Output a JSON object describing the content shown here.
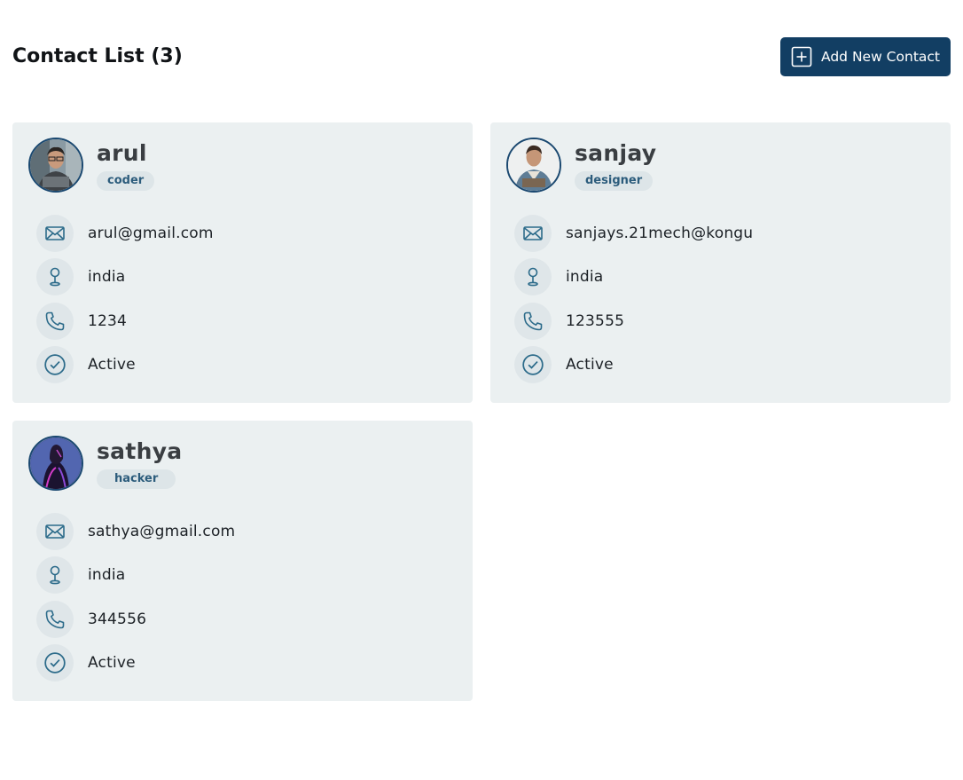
{
  "header": {
    "title": "Contact List (3)",
    "add_button_label": "Add New Contact"
  },
  "colors": {
    "accent": "#123e63",
    "card_bg": "#ebf0f1",
    "icon": "#2c6b8a"
  },
  "contacts": [
    {
      "name": "arul",
      "role": "coder",
      "email": "arul@gmail.com",
      "location": "india",
      "phone": "1234",
      "status": "Active"
    },
    {
      "name": "sanjay",
      "role": "designer",
      "email": "sanjays.21mech@kongu",
      "location": "india",
      "phone": "123555",
      "status": "Active"
    },
    {
      "name": "sathya",
      "role": "hacker",
      "email": "sathya@gmail.com",
      "location": "india",
      "phone": "344556",
      "status": "Active"
    }
  ],
  "icons": {
    "add": "plus-square-icon",
    "email": "mail-icon",
    "location": "map-pin-icon",
    "phone": "phone-icon",
    "status": "check-circle-icon"
  }
}
